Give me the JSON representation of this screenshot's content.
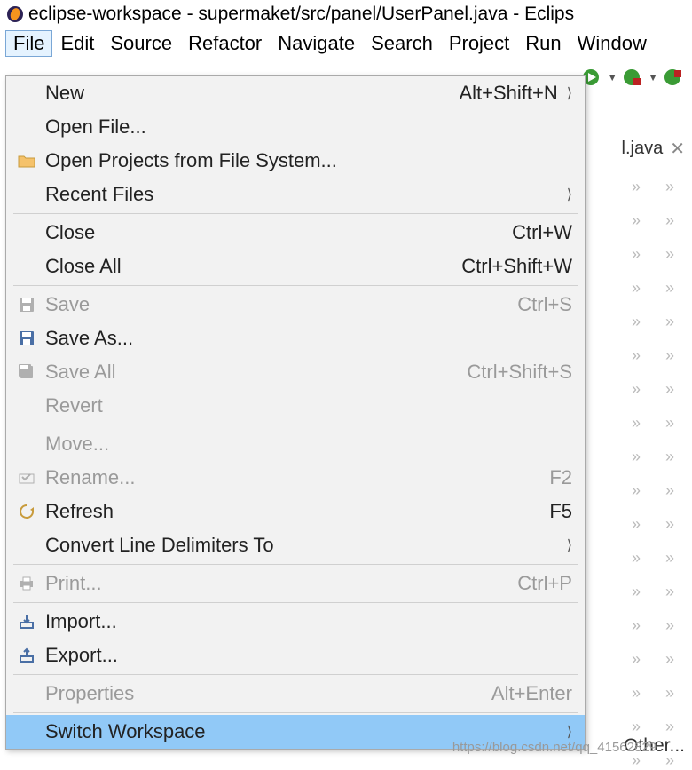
{
  "window": {
    "title": "eclipse-workspace - supermaket/src/panel/UserPanel.java - Eclips"
  },
  "menubar": {
    "items": [
      "File",
      "Edit",
      "Source",
      "Refactor",
      "Navigate",
      "Search",
      "Project",
      "Run",
      "Window"
    ]
  },
  "tab": {
    "label": "l.java",
    "close": "✕"
  },
  "file_menu": {
    "items": [
      {
        "label": "New",
        "shortcut": "Alt+Shift+N",
        "submenu": true,
        "icon": ""
      },
      {
        "label": "Open File...",
        "shortcut": "",
        "icon": ""
      },
      {
        "label": "Open Projects from File System...",
        "shortcut": "",
        "icon": "folder"
      },
      {
        "label": "Recent Files",
        "shortcut": "",
        "submenu": true,
        "icon": ""
      },
      {
        "sep": true
      },
      {
        "label": "Close",
        "shortcut": "Ctrl+W",
        "icon": ""
      },
      {
        "label": "Close All",
        "shortcut": "Ctrl+Shift+W",
        "icon": ""
      },
      {
        "sep": true
      },
      {
        "label": "Save",
        "shortcut": "Ctrl+S",
        "icon": "save",
        "disabled": true
      },
      {
        "label": "Save As...",
        "shortcut": "",
        "icon": "saveas"
      },
      {
        "label": "Save All",
        "shortcut": "Ctrl+Shift+S",
        "icon": "saveall",
        "disabled": true
      },
      {
        "label": "Revert",
        "shortcut": "",
        "icon": "",
        "disabled": true
      },
      {
        "sep": true
      },
      {
        "label": "Move...",
        "shortcut": "",
        "icon": "",
        "disabled": true
      },
      {
        "label": "Rename...",
        "shortcut": "F2",
        "icon": "rename",
        "disabled": true
      },
      {
        "label": "Refresh",
        "shortcut": "F5",
        "icon": "refresh"
      },
      {
        "label": "Convert Line Delimiters To",
        "shortcut": "",
        "submenu": true,
        "icon": ""
      },
      {
        "sep": true
      },
      {
        "label": "Print...",
        "shortcut": "Ctrl+P",
        "icon": "print",
        "disabled": true
      },
      {
        "sep": true
      },
      {
        "label": "Import...",
        "shortcut": "",
        "icon": "import"
      },
      {
        "label": "Export...",
        "shortcut": "",
        "icon": "export"
      },
      {
        "sep": true
      },
      {
        "label": "Properties",
        "shortcut": "Alt+Enter",
        "icon": "",
        "disabled": true
      },
      {
        "sep": true
      },
      {
        "label": "Switch Workspace",
        "shortcut": "",
        "submenu": true,
        "icon": "",
        "highlight": true
      }
    ],
    "submenu_item": "Other..."
  },
  "watermark": "https://blog.csdn.net/qq_41562829"
}
